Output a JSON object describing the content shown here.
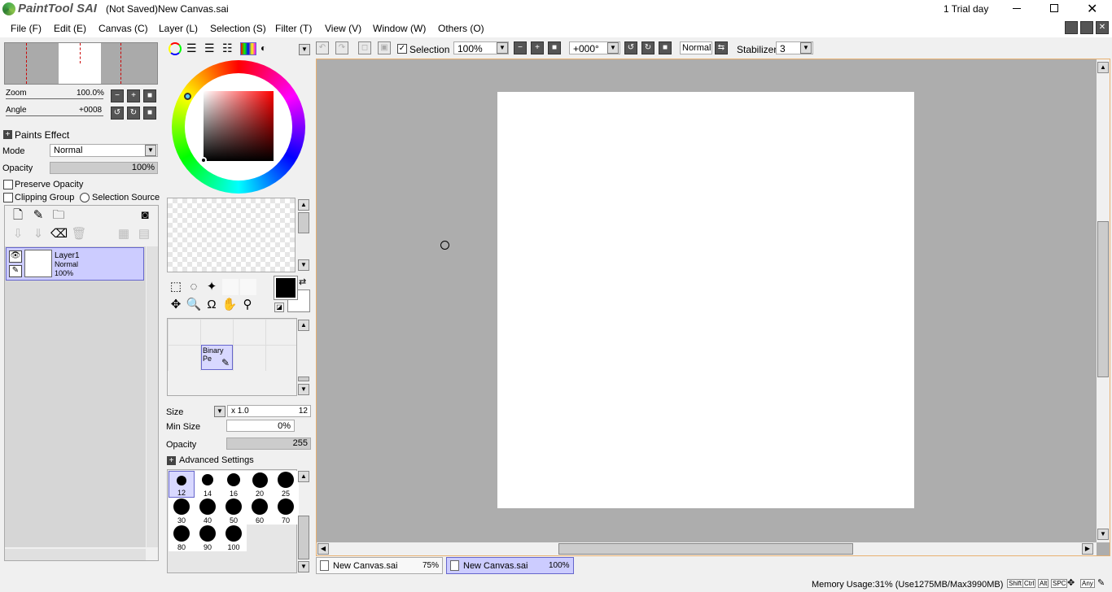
{
  "app": {
    "logo_text": "PaintTool SAI",
    "title": "(Not Saved)New Canvas.sai",
    "trial": "1 Trial day"
  },
  "menu": [
    "File (F)",
    "Edit (E)",
    "Canvas (C)",
    "Layer (L)",
    "Selection (S)",
    "Filter (T)",
    "View (V)",
    "Window (W)",
    "Others (O)"
  ],
  "navigator": {
    "zoom_label": "Zoom",
    "zoom_value": "100.0%",
    "angle_label": "Angle",
    "angle_value": "+0008"
  },
  "layer_panel": {
    "paints_effect": "Paints Effect",
    "mode_label": "Mode",
    "mode_value": "Normal",
    "opacity_label": "Opacity",
    "opacity_value": "100%",
    "preserve_opacity": "Preserve Opacity",
    "clipping_group": "Clipping Group",
    "selection_source": "Selection Source",
    "layer": {
      "name": "Layer1",
      "mode": "Normal",
      "opacity": "100%"
    }
  },
  "brush": {
    "tool_name": "Binary Pe",
    "size_label": "Size",
    "size_mult": "x 1.0",
    "size_value": "12",
    "min_size_label": "Min Size",
    "min_size_value": "0%",
    "opacity_label": "Opacity",
    "opacity_value": "255",
    "advanced": "Advanced Settings",
    "sizes": [
      "12",
      "14",
      "16",
      "20",
      "25",
      "30",
      "40",
      "50",
      "60",
      "70",
      "80",
      "90",
      "100"
    ]
  },
  "toolbar": {
    "selection_label": "Selection",
    "zoom": "100%",
    "angle": "+000°",
    "blend": "Normal",
    "stabilizer_label": "Stabilizer",
    "stabilizer_value": "3"
  },
  "tabs": [
    {
      "name": "New Canvas.sai",
      "zoom": "75%"
    },
    {
      "name": "New Canvas.sai",
      "zoom": "100%"
    }
  ],
  "status": {
    "memory": "Memory Usage:31% (Use1275MB/Max3990MB)",
    "keys": [
      "Shift",
      "Ctrl",
      "Alt",
      "SPC",
      "Any"
    ]
  }
}
